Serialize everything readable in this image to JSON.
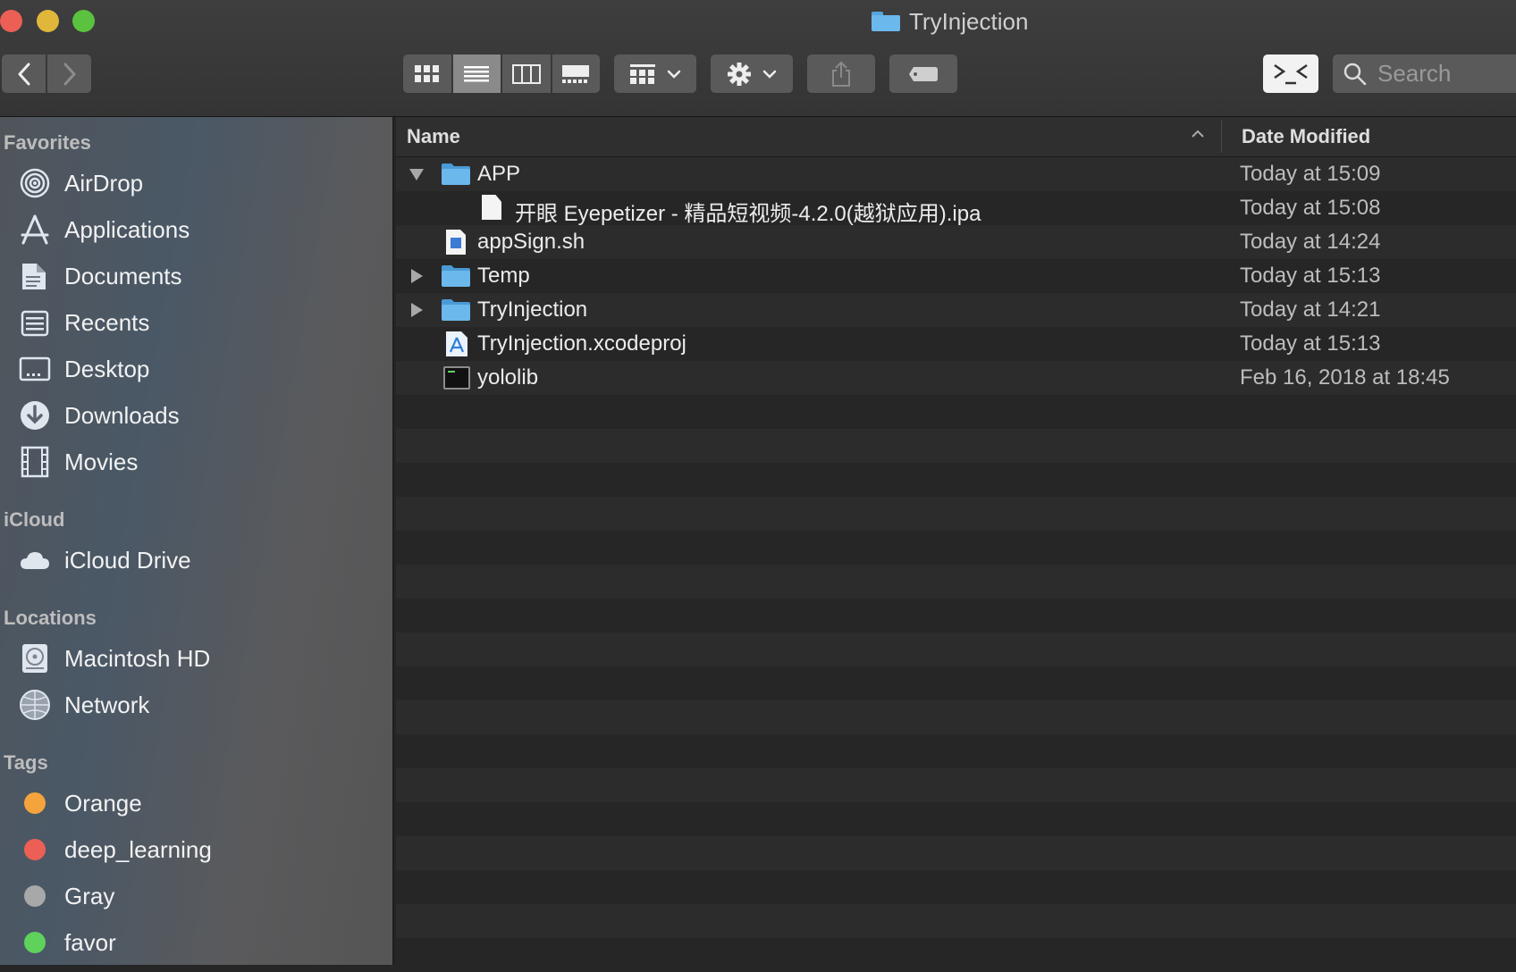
{
  "window": {
    "title": "TryInjection"
  },
  "toolbar": {
    "back_icon": "chevron-left-icon",
    "forward_icon": "chevron-right-icon",
    "views": [
      "icon-view",
      "list-view",
      "column-view",
      "gallery-view"
    ],
    "active_view": "list-view",
    "search_placeholder": "Search"
  },
  "sidebar": {
    "favorites_header": "Favorites",
    "favorites": [
      {
        "label": "AirDrop",
        "icon": "airdrop-icon"
      },
      {
        "label": "Applications",
        "icon": "applications-icon"
      },
      {
        "label": "Documents",
        "icon": "documents-icon"
      },
      {
        "label": "Recents",
        "icon": "recents-icon"
      },
      {
        "label": "Desktop",
        "icon": "desktop-icon"
      },
      {
        "label": "Downloads",
        "icon": "downloads-icon"
      },
      {
        "label": "Movies",
        "icon": "movies-icon"
      }
    ],
    "icloud_header": "iCloud",
    "icloud": [
      {
        "label": "iCloud Drive",
        "icon": "cloud-icon"
      }
    ],
    "locations_header": "Locations",
    "locations": [
      {
        "label": "Macintosh HD",
        "icon": "harddisk-icon"
      },
      {
        "label": "Network",
        "icon": "network-icon"
      }
    ],
    "tags_header": "Tags",
    "tags": [
      {
        "label": "Orange",
        "color": "#f5a33c"
      },
      {
        "label": "deep_learning",
        "color": "#ec5f55"
      },
      {
        "label": "Gray",
        "color": "#a8a8a8"
      },
      {
        "label": "favor",
        "color": "#5ed25a"
      }
    ]
  },
  "columns": {
    "name": "Name",
    "date": "Date Modified"
  },
  "files": [
    {
      "name": "APP",
      "date": "Today at 15:09",
      "type": "folder",
      "disclosure": "expanded",
      "depth": 0
    },
    {
      "name": "开眼 Eyepetizer - 精品短视频-4.2.0(越狱应用).ipa",
      "date": "Today at 15:08",
      "type": "document",
      "disclosure": "none",
      "depth": 1
    },
    {
      "name": "appSign.sh",
      "date": "Today at 14:24",
      "type": "script",
      "disclosure": "none",
      "depth": 0
    },
    {
      "name": "Temp",
      "date": "Today at 15:13",
      "type": "folder",
      "disclosure": "collapsed",
      "depth": 0
    },
    {
      "name": "TryInjection",
      "date": "Today at 14:21",
      "type": "folder",
      "disclosure": "collapsed",
      "depth": 0
    },
    {
      "name": "TryInjection.xcodeproj",
      "date": "Today at 15:13",
      "type": "xcodeproj",
      "disclosure": "none",
      "depth": 0
    },
    {
      "name": "yololib",
      "date": "Feb 16, 2018 at 18:45",
      "type": "executable",
      "disclosure": "none",
      "depth": 0
    }
  ]
}
